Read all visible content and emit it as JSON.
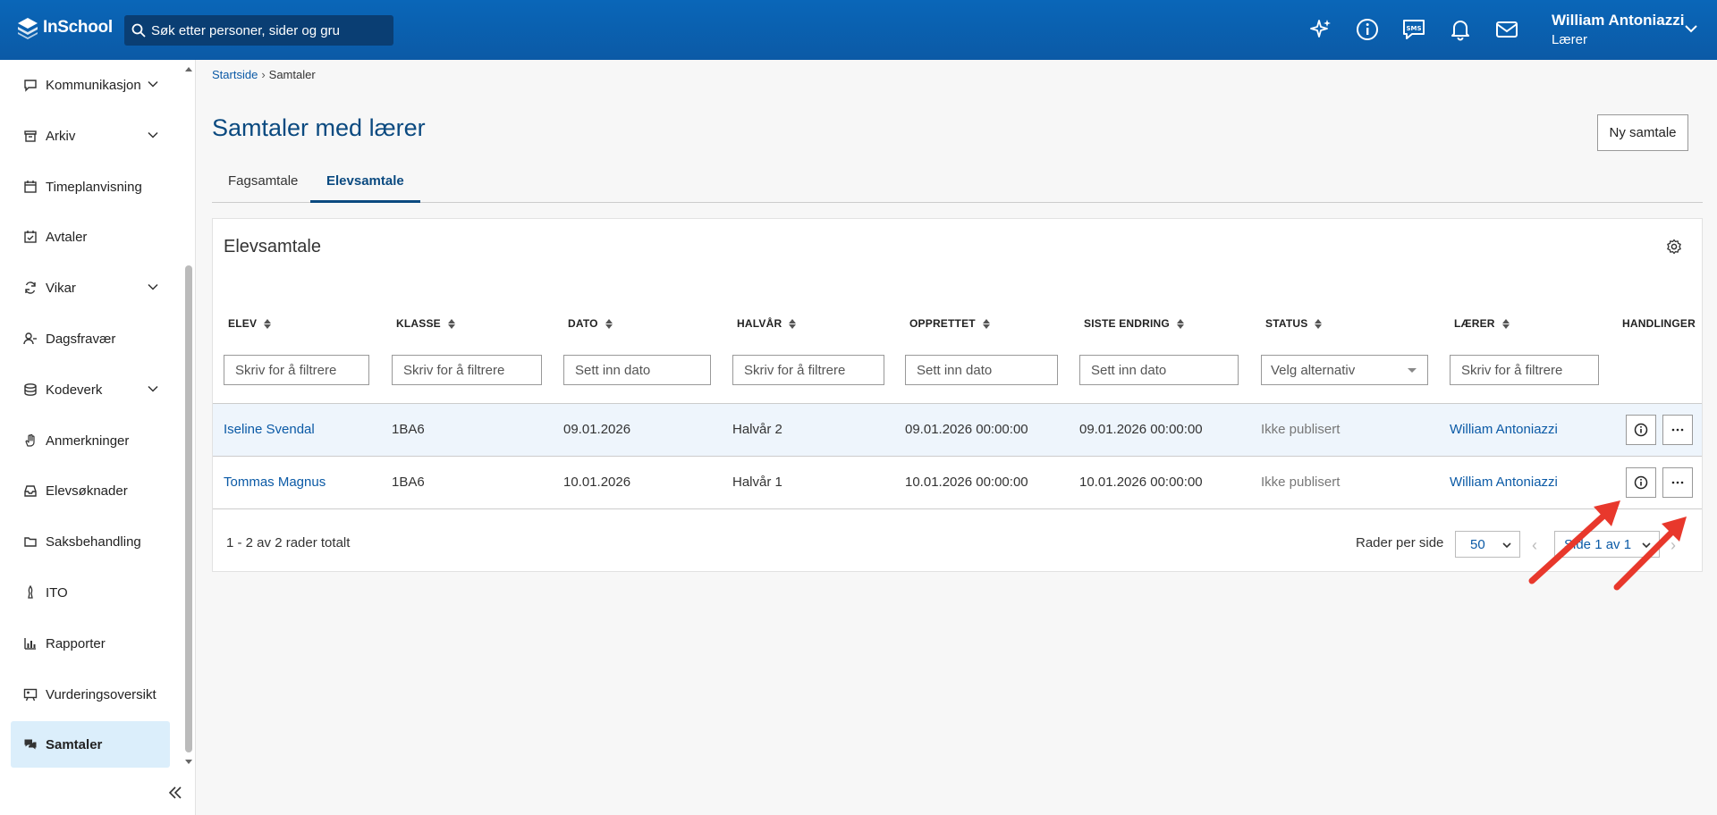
{
  "app": {
    "name": "InSchool"
  },
  "search": {
    "placeholder": "Søk etter personer, sider og gru"
  },
  "user": {
    "name": "William Antoniazzi",
    "role": "Lærer"
  },
  "top_icons": [
    "sparkle-icon",
    "info-icon",
    "sms-icon",
    "bell-icon",
    "mail-icon"
  ],
  "sidebar": {
    "items": [
      {
        "label": "Kommunikasjon",
        "icon": "chat-icon",
        "expandable": true
      },
      {
        "label": "Arkiv",
        "icon": "archive-icon",
        "expandable": true
      },
      {
        "label": "Timeplanvisning",
        "icon": "calendar-icon",
        "expandable": false
      },
      {
        "label": "Avtaler",
        "icon": "calendar-check-icon",
        "expandable": false
      },
      {
        "label": "Vikar",
        "icon": "refresh-icon",
        "expandable": true
      },
      {
        "label": "Dagsfravær",
        "icon": "user-minus-icon",
        "expandable": false
      },
      {
        "label": "Kodeverk",
        "icon": "database-icon",
        "expandable": true
      },
      {
        "label": "Anmerkninger",
        "icon": "hand-icon",
        "expandable": false
      },
      {
        "label": "Elevsøknader",
        "icon": "inbox-icon",
        "expandable": false
      },
      {
        "label": "Saksbehandling",
        "icon": "folder-icon",
        "expandable": false
      },
      {
        "label": "ITO",
        "icon": "pen-icon",
        "expandable": false
      },
      {
        "label": "Rapporter",
        "icon": "bar-chart-icon",
        "expandable": false
      },
      {
        "label": "Vurderingsoversikt",
        "icon": "presentation-icon",
        "expandable": false
      },
      {
        "label": "Samtaler",
        "icon": "comments-icon",
        "expandable": false,
        "active": true
      }
    ]
  },
  "breadcrumb": {
    "home": "Startside",
    "current": "Samtaler"
  },
  "page": {
    "title": "Samtaler med lærer",
    "new_button": "Ny samtale"
  },
  "tabs": [
    {
      "label": "Fagsamtale",
      "active": false
    },
    {
      "label": "Elevsamtale",
      "active": true
    }
  ],
  "table": {
    "title": "Elevsamtale",
    "columns": [
      {
        "label": "ELEV",
        "sortable": true,
        "filter": "Skriv for å filtrere",
        "filter_type": "text"
      },
      {
        "label": "KLASSE",
        "sortable": true,
        "filter": "Skriv for å filtrere",
        "filter_type": "text"
      },
      {
        "label": "DATO",
        "sortable": true,
        "filter": "Sett inn dato",
        "filter_type": "date"
      },
      {
        "label": "HALVÅR",
        "sortable": true,
        "filter": "Skriv for å filtrere",
        "filter_type": "text"
      },
      {
        "label": "OPPRETTET",
        "sortable": true,
        "filter": "Sett inn dato",
        "filter_type": "date"
      },
      {
        "label": "SISTE ENDRING",
        "sortable": true,
        "filter": "Sett inn dato",
        "filter_type": "date"
      },
      {
        "label": "STATUS",
        "sortable": true,
        "filter": "Velg alternativ",
        "filter_type": "select"
      },
      {
        "label": "LÆRER",
        "sortable": true,
        "filter": "Skriv for å filtrere",
        "filter_type": "text"
      },
      {
        "label": "HANDLINGER",
        "sortable": false
      }
    ],
    "rows": [
      {
        "elev": "Iseline Svendal",
        "klasse": "1BA6",
        "dato": "09.01.2026",
        "halvar": "Halvår 2",
        "opprettet": "09.01.2026 00:00:00",
        "siste_endring": "09.01.2026 00:00:00",
        "status": "Ikke publisert",
        "laerer": "William Antoniazzi",
        "selected": true
      },
      {
        "elev": "Tommas Magnus",
        "klasse": "1BA6",
        "dato": "10.01.2026",
        "halvar": "Halvår 1",
        "opprettet": "10.01.2026 00:00:00",
        "siste_endring": "10.01.2026 00:00:00",
        "status": "Ikke publisert",
        "laerer": "William Antoniazzi",
        "selected": false
      }
    ],
    "footer": {
      "total": "1 - 2 av 2 rader totalt",
      "rows_per_page_label": "Rader per side",
      "rows_per_page": "50",
      "page": "Side 1 av 1"
    }
  },
  "colors": {
    "brand": "#0b5aa6",
    "active_bg": "#dbeefb",
    "annotation_arrow": "#e8382c"
  }
}
